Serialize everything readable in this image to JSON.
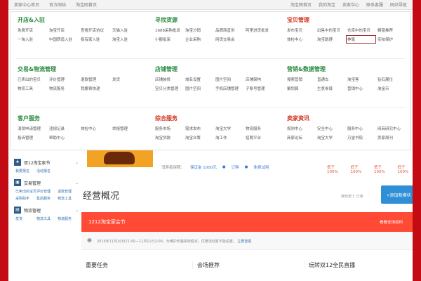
{
  "topbar": {
    "left": [
      "卖家中心首页",
      "官方网站",
      "淘宝网首页"
    ],
    "right": [
      "淘宝网首页",
      "我的淘宝",
      "卖家中心",
      "联系客服",
      "网站导航"
    ]
  },
  "menu": {
    "open_store": {
      "title": "开店&入驻",
      "links": [
        "免费开店",
        "淘宝开店",
        "查看开店协议",
        "天猫入驻",
        "一淘入驻",
        "中国质造入驻",
        "极有家入驻",
        "淘宝入驻"
      ]
    },
    "sourcing": {
      "title": "寻找货源",
      "links": [
        "1688采购批发",
        "淘宝分销",
        "品牌商直供",
        "阿里进货批发",
        "小额批采",
        "企业采购",
        "网货交易会",
        ""
      ]
    },
    "items": {
      "title": "宝贝管理",
      "links": [
        "发布宝贝",
        "出售中的宝贝",
        "仓库中的宝贝",
        "橱窗推荐",
        "体检中心",
        "淘宝助理",
        "神笔",
        "实拍保护"
      ]
    },
    "trade": {
      "title": "交易&物流管理",
      "links": [
        "已卖出的宝贝",
        "评价管理",
        "退款管理",
        "发货",
        "物流工具",
        "物流服务",
        "我要寄快递",
        ""
      ]
    },
    "shop": {
      "title": "店铺管理",
      "links": [
        "店铺装修",
        "域名设置",
        "图片空间",
        "店铺架构",
        "宝贝分类管理",
        "图片空间",
        "手机店铺管理",
        "子账号管理"
      ]
    },
    "marketing": {
      "title": "营销&数据管理",
      "links": [
        "搜索营销",
        "直通车",
        "淘宝客",
        "钻石展位",
        "聚划算",
        "生意参谋",
        "营销中心",
        "淘金币"
      ]
    },
    "service": {
      "title": "客户服务",
      "links": [
        "消保申请管理",
        "违规记录",
        "体检中心",
        "举报管理",
        "投诉管理",
        "帮助中心",
        "",
        ""
      ]
    },
    "general": {
      "title": "综合服务",
      "links": [
        "服务市场",
        "需求发布",
        "淘宝大学",
        "物流服务",
        "淘宝贷款",
        "淘宝众筹",
        "淘工作",
        "招聘平台"
      ]
    },
    "seller": {
      "title": "卖家资讯",
      "links": [
        "规则中心",
        "安全中心",
        "服务中心",
        "网商研究中心",
        "商家论坛",
        "淘宝大学",
        "万堂书院",
        "卖家周刊"
      ]
    }
  },
  "highlighted_link": "神笔",
  "shop_header": {
    "meta": [
      "消费者保障：",
      "保证金 1000元",
      "订购",
      "免费试用"
    ],
    "stats": [
      "低于100%",
      "低于100%",
      "低于100%",
      "低于100%"
    ]
  },
  "sidebar": {
    "sections": [
      {
        "title": "双12淘宝家节",
        "icon": "star-icon",
        "links": [
          "我要报名",
          "活动报名"
        ]
      },
      {
        "title": "交易管理",
        "icon": "cart-icon",
        "links": [
          "已卖出的宝贝",
          "评价管理",
          "退款管理",
          "采购助手",
          "售后服务",
          "物流工具"
        ]
      },
      {
        "title": "物流管理",
        "icon": "truck-icon",
        "links": [
          "发货",
          "物流工具",
          "物流服务"
        ]
      }
    ]
  },
  "main": {
    "title": "经营概况",
    "right_text": "我知道了 已读",
    "add_button": "+添加新模块",
    "banner_title": "1212淘宝家会节",
    "banner_right": "看看全场如何",
    "notice_text": "2016年11月10日21:00—11月11日2:00，为维护天猫系统稳定，优惠活动暂不能设置。",
    "notice_link": "立即查看",
    "sections": [
      "重要任务",
      "会场推荐",
      "玩转双12全民直播"
    ]
  }
}
